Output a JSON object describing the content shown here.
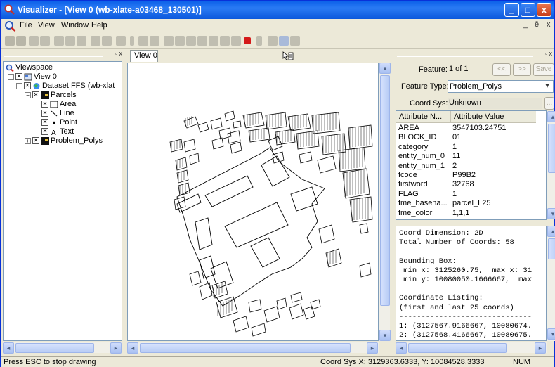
{
  "window": {
    "title": "Visualizer - [View 0 (wb-xlate-a03468_130501)]",
    "minimize": "_",
    "maximize": "□",
    "close": "x"
  },
  "menu": {
    "items": [
      "File",
      "View",
      "Window",
      "Help"
    ],
    "doc_min": "_",
    "doc_restore": "ē",
    "doc_close": "x"
  },
  "tree": {
    "root": "Viewspace",
    "view": "View 0",
    "dataset": "Dataset FFS (wb-xlat",
    "group": "Parcels",
    "geom": [
      "Area",
      "Line",
      "Point",
      "Text"
    ],
    "group2": "Problem_Polys"
  },
  "view_tab": "View 0",
  "feature": {
    "feature_label": "Feature:",
    "feature_value": "1 of 1",
    "prev": "<<",
    "next": ">>",
    "save": "Save",
    "type_label": "Feature Type:",
    "type_value": "Problem_Polys",
    "coord_label": "Coord Sys:",
    "coord_value": "Unknown",
    "more": "..."
  },
  "attributes": {
    "columns": [
      "Attribute N...",
      "Attribute Value"
    ],
    "rows": [
      [
        "AREA",
        "3547103.24751"
      ],
      [
        "BLOCK_ID",
        "01"
      ],
      [
        "category",
        "1"
      ],
      [
        "entity_num_0",
        "11"
      ],
      [
        "entity_num_1",
        "2"
      ],
      [
        "fcode",
        "P99B2"
      ],
      [
        "firstword",
        "32768"
      ],
      [
        "FLAG",
        "1"
      ],
      [
        "fme_basena...",
        "parcel_L25"
      ],
      [
        "fme_color",
        "1,1,1"
      ]
    ]
  },
  "console_lines": [
    "Coord Dimension: 2D",
    "Total Number of Coords: 58",
    "",
    "Bounding Box:",
    " min x: 3125260.75,  max x: 31",
    " min y: 10080050.1666667,  max",
    "",
    "Coordinate Listing:",
    "(first and last 25 coords)",
    "------------------------------",
    "1: (3127567.9166667, 10080674.",
    "2: (3127568.4166667, 10080675."
  ],
  "status": {
    "left": "Press ESC to stop drawing",
    "coords": "Coord Sys  X: 3129363.6333, Y: 10084528.3333",
    "num": "NUM"
  }
}
